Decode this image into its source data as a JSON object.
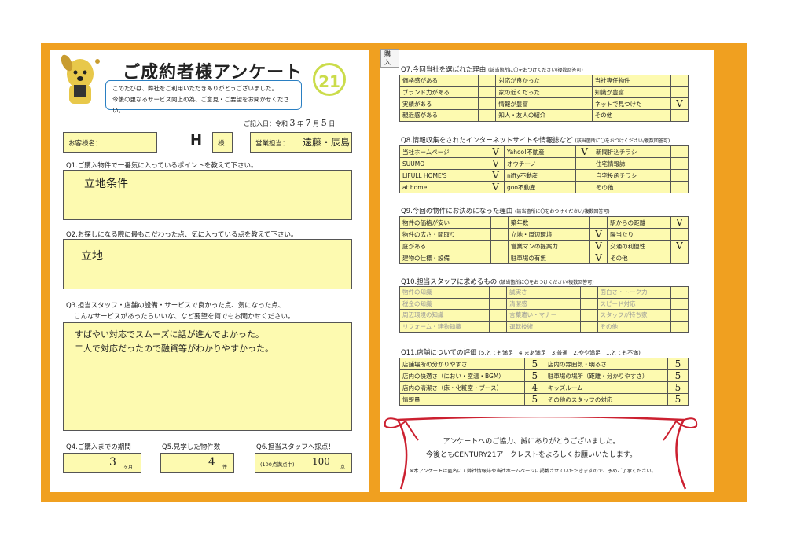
{
  "tag": "購入",
  "title": "ご成約者様アンケート",
  "intro": [
    "このたびは、弊社をご利用いただきありがとうございました。",
    "今後の更なるサービス向上の為、ご意見・ご要望をお聞かせください。"
  ],
  "logo": "21",
  "date": {
    "label": "ご記入日：令和",
    "year": "3",
    "year_u": "年",
    "month": "7",
    "month_u": "月",
    "day": "5",
    "day_u": "日"
  },
  "customer": {
    "label": "お客様名：",
    "value": "H",
    "suffix": "様",
    "staff_label": "営業担当：",
    "staff_value": "遠藤・辰島"
  },
  "q1": {
    "q": "Q1.ご購入物件で一番気に入っているポイントを教えて下さい。",
    "a": "立地条件"
  },
  "q2": {
    "q": "Q2.お探しになる際に最もこだわった点、気に入っている点を教えて下さい。",
    "a": "立地"
  },
  "q3": {
    "q1": "Q3.担当スタッフ・店舗の設備・サービスで良かった点、気になった点、",
    "q2": "こんなサービスがあったらいいな、など要望を何でもお聞かせください。",
    "a1": "すばやい対応でスムーズに話が進んでよかった。",
    "a2": "二人で対応だったので融資等がわかりやすかった。"
  },
  "q4": {
    "q": "Q4.ご購入までの期間",
    "value": "3",
    "unit": "ヶ月"
  },
  "q5": {
    "q": "Q5.見学した物件数",
    "value": "4",
    "unit": "件"
  },
  "q6": {
    "q": "Q6.担当スタッフへ採点！",
    "label": "(100点満点中)",
    "value": "100",
    "unit": "点"
  },
  "q7": {
    "q": "Q7.今回当社を選ばれた理由",
    "note": "(該当箇所に〇をおつけください/複数回答可)",
    "rows": [
      [
        [
          "価格感がある",
          ""
        ],
        [
          "対応が良かった",
          ""
        ],
        [
          "当社専任物件",
          ""
        ]
      ],
      [
        [
          "ブランド力がある",
          ""
        ],
        [
          "家の近くだった",
          ""
        ],
        [
          "知識が豊富",
          ""
        ]
      ],
      [
        [
          "実績がある",
          ""
        ],
        [
          "情報が豊富",
          ""
        ],
        [
          "ネットで見つけた",
          "V"
        ]
      ],
      [
        [
          "親近感がある",
          ""
        ],
        [
          "知人・友人の紹介",
          ""
        ],
        [
          "その他",
          ""
        ]
      ]
    ]
  },
  "q8": {
    "q": "Q8.情報収集をされたインターネットサイトや情報誌など",
    "note": "(該当箇所に〇をおつけください/複数回答可)",
    "rows": [
      [
        [
          "当社ホームページ",
          "V"
        ],
        [
          "Yahoo!不動産",
          "V"
        ],
        [
          "新聞折込チラシ",
          ""
        ]
      ],
      [
        [
          "SUUMO",
          "V"
        ],
        [
          "オウチーノ",
          ""
        ],
        [
          "住宅情報誌",
          ""
        ]
      ],
      [
        [
          "LIFULL HOME'S",
          "V"
        ],
        [
          "nifty不動産",
          ""
        ],
        [
          "自宅投函チラシ",
          ""
        ]
      ],
      [
        [
          "at home",
          "V"
        ],
        [
          "goo不動産",
          ""
        ],
        [
          "その他",
          ""
        ]
      ]
    ]
  },
  "q9": {
    "q": "Q9.今回の物件にお決めになった理由",
    "note": "(該当箇所に〇をおつけください/複数回答可)",
    "rows": [
      [
        [
          "物件の価格が安い",
          ""
        ],
        [
          "築年数",
          ""
        ],
        [
          "駅からの距離",
          "V"
        ]
      ],
      [
        [
          "物件の広さ・間取り",
          ""
        ],
        [
          "立地・周辺環境",
          "V"
        ],
        [
          "陽当たり",
          ""
        ]
      ],
      [
        [
          "庭がある",
          ""
        ],
        [
          "営業マンの提案力",
          "V"
        ],
        [
          "交通の利便性",
          "V"
        ]
      ],
      [
        [
          "建物の仕様・設備",
          ""
        ],
        [
          "駐車場の有無",
          "V"
        ],
        [
          "その他",
          ""
        ]
      ]
    ]
  },
  "q10": {
    "q": "Q10.担当スタッフに求めるもの",
    "note": "(該当箇所に〇をおつけください/複数回答可)",
    "rows": [
      [
        [
          "物件の知識",
          ""
        ],
        [
          "誠実さ",
          ""
        ],
        [
          "面白さ・トーク力",
          ""
        ]
      ],
      [
        [
          "税金の知識",
          ""
        ],
        [
          "清潔感",
          ""
        ],
        [
          "スピード対応",
          ""
        ]
      ],
      [
        [
          "周辺環境の知識",
          ""
        ],
        [
          "言葉遣い・マナー",
          ""
        ],
        [
          "スタッフが持ち家",
          ""
        ]
      ],
      [
        [
          "リフォーム・建物知識",
          ""
        ],
        [
          "運転技術",
          ""
        ],
        [
          "その他",
          ""
        ]
      ]
    ]
  },
  "q11": {
    "q": "Q11.店舗についての評価",
    "scale": "(5.とても満足　4.まあ満足　3.普通　2.やや満足　1.とても不満)",
    "rows": [
      [
        [
          "店舗場所の分かりやすさ",
          "5"
        ],
        [
          "店内の雰囲気・明るさ",
          "5"
        ]
      ],
      [
        [
          "店内の快適さ（におい・室温・BGM）",
          "5"
        ],
        [
          "駐車場の場所（距離・分かりやすさ）",
          "5"
        ]
      ],
      [
        [
          "店内の清潔さ（床・化粧室・ブース）",
          "4"
        ],
        [
          "キッズルーム",
          "5"
        ]
      ],
      [
        [
          "情報量",
          "5"
        ],
        [
          "その他のスタッフの対応",
          "5"
        ]
      ]
    ]
  },
  "thanks": {
    "line1": "アンケートへのご協力、誠にありがとうございました。",
    "line2": "今後ともCENTURY21アークレストをよろしくお願いいたします。",
    "note": "※本アンケートは匿名にて弊社情報誌や当社ホームページに掲載させていただきますので、予めご了承ください。"
  },
  "colors": {
    "frame": "#f0a020",
    "field": "#fdfab0",
    "logo": "#cbdc4a",
    "ribbon": "#cc2030",
    "bubble": "#2a7fc2"
  }
}
